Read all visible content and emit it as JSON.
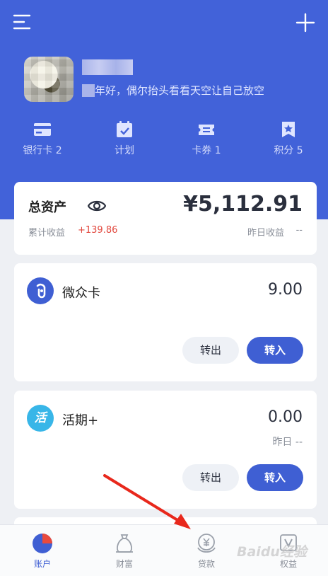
{
  "colors": {
    "brand": "#4262d9",
    "primary_button": "#3f5fd3",
    "positive": "#e2493f"
  },
  "header": {
    "bio": "年好，偶尔抬头看看天空让自己放空",
    "quick_links": [
      {
        "label": "银行卡 2",
        "icon": "bank-card-icon"
      },
      {
        "label": "计划",
        "icon": "calendar-check-icon"
      },
      {
        "label": "卡券 1",
        "icon": "ticket-icon"
      },
      {
        "label": "积分 5",
        "icon": "bookmark-star-icon"
      }
    ]
  },
  "assets": {
    "title": "总资产",
    "amount": "¥5,112.91",
    "cumulative_label": "累计收益",
    "cumulative_value": "+139.86",
    "yesterday_label": "昨日收益",
    "yesterday_value": "--"
  },
  "products": [
    {
      "name": "微众卡",
      "icon_glyph": "",
      "icon_color": "#3f5fd3",
      "amount": "9.00",
      "sub": "",
      "out_label": "转出",
      "in_label": "转入"
    },
    {
      "name": "活期+",
      "icon_glyph": "活",
      "icon_color": "#38b6e8",
      "amount": "0.00",
      "sub": "昨日 --",
      "out_label": "转出",
      "in_label": "转入"
    }
  ],
  "tabbar": [
    {
      "label": "账户",
      "icon": "pie-chart-icon",
      "active": true
    },
    {
      "label": "财富",
      "icon": "money-bag-icon",
      "active": false
    },
    {
      "label": "贷款",
      "icon": "yuan-coin-icon",
      "active": false
    },
    {
      "label": "权益",
      "icon": "vip-badge-icon",
      "active": false
    }
  ],
  "watermark": "Baidu经验"
}
